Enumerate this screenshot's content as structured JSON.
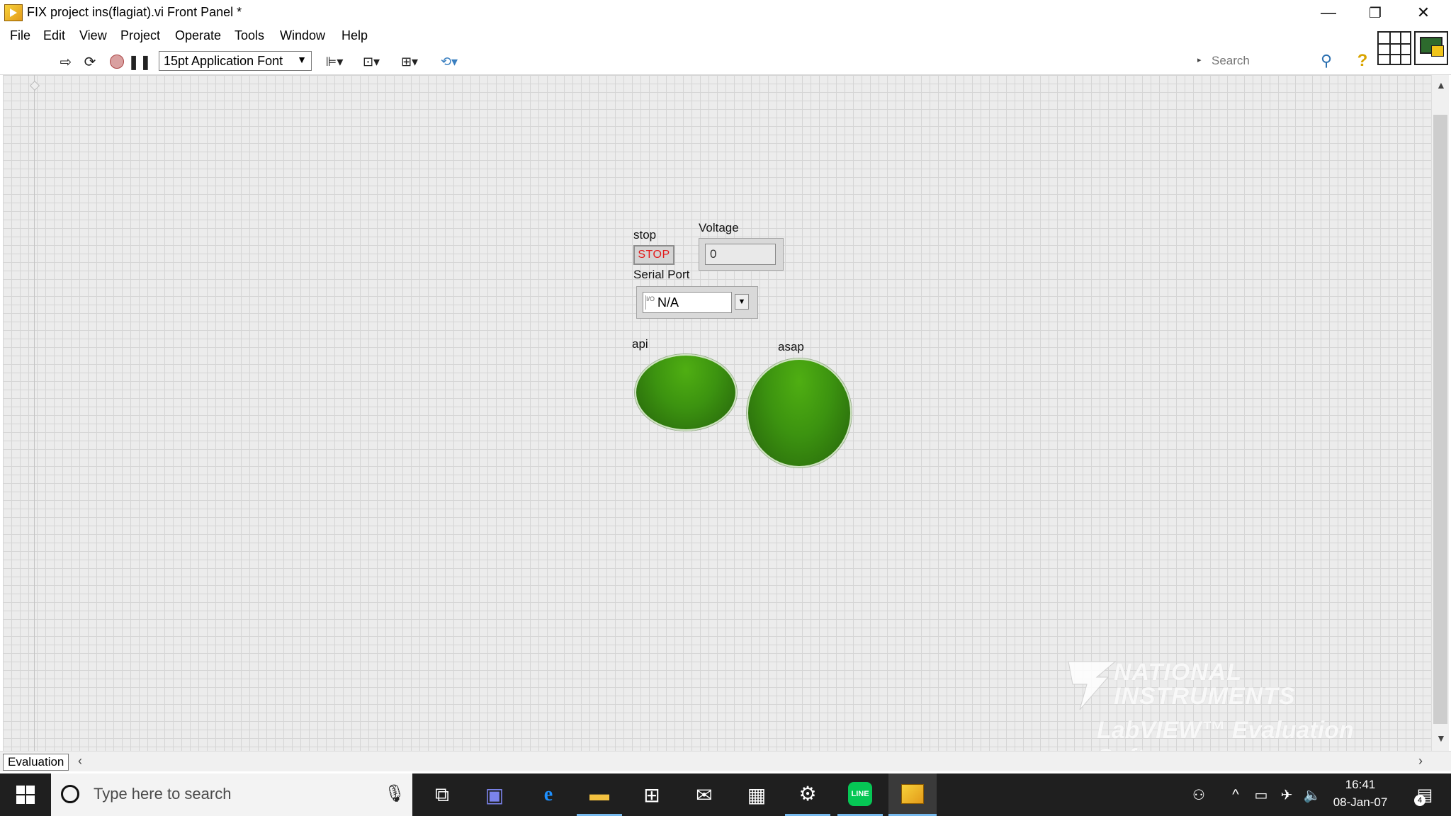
{
  "window": {
    "title": "FIX project ins(flagiat).vi Front Panel *",
    "minimize_glyph": "—",
    "restore_glyph": "❐",
    "close_glyph": "✕"
  },
  "menu": {
    "items": [
      "File",
      "Edit",
      "View",
      "Project",
      "Operate",
      "Tools",
      "Window",
      "Help"
    ]
  },
  "toolbar": {
    "run_icon": "run-arrow-icon",
    "run_continuously_icon": "run-continuously-icon",
    "abort_icon": "abort-icon",
    "pause_icon": "pause-icon",
    "font_select": "15pt Application Font",
    "align_icon": "align-objects-icon",
    "distribute_icon": "distribute-objects-icon",
    "resize_icon": "resize-objects-icon",
    "reorder_icon": "reorder-icon",
    "search_placeholder": "Search",
    "help_glyph": "?"
  },
  "front_panel": {
    "stop": {
      "label": "stop",
      "button_text": "STOP"
    },
    "voltage": {
      "label": "Voltage",
      "value": "0"
    },
    "serial_port": {
      "label": "Serial Port",
      "value": "N/A"
    },
    "led_api": {
      "label": "api",
      "state": "on",
      "color": "#3c9310"
    },
    "led_asap": {
      "label": "asap",
      "state": "on",
      "color": "#3c9310"
    },
    "watermark": {
      "line1": "NATIONAL",
      "line2": "INSTRUMENTS",
      "line3": "LabVIEW™ Evaluation Software"
    }
  },
  "status": {
    "tab_label": "Evaluation"
  },
  "taskbar": {
    "search_placeholder": "Type here to search",
    "apps": [
      "task-view-icon",
      "teams-icon",
      "edge-icon",
      "file-explorer-icon",
      "store-icon",
      "mail-icon",
      "calendar-icon",
      "settings-icon",
      "line-icon",
      "labview-icon"
    ],
    "time": "16:41",
    "date": "08-Jan-07",
    "notification_count": "4"
  }
}
